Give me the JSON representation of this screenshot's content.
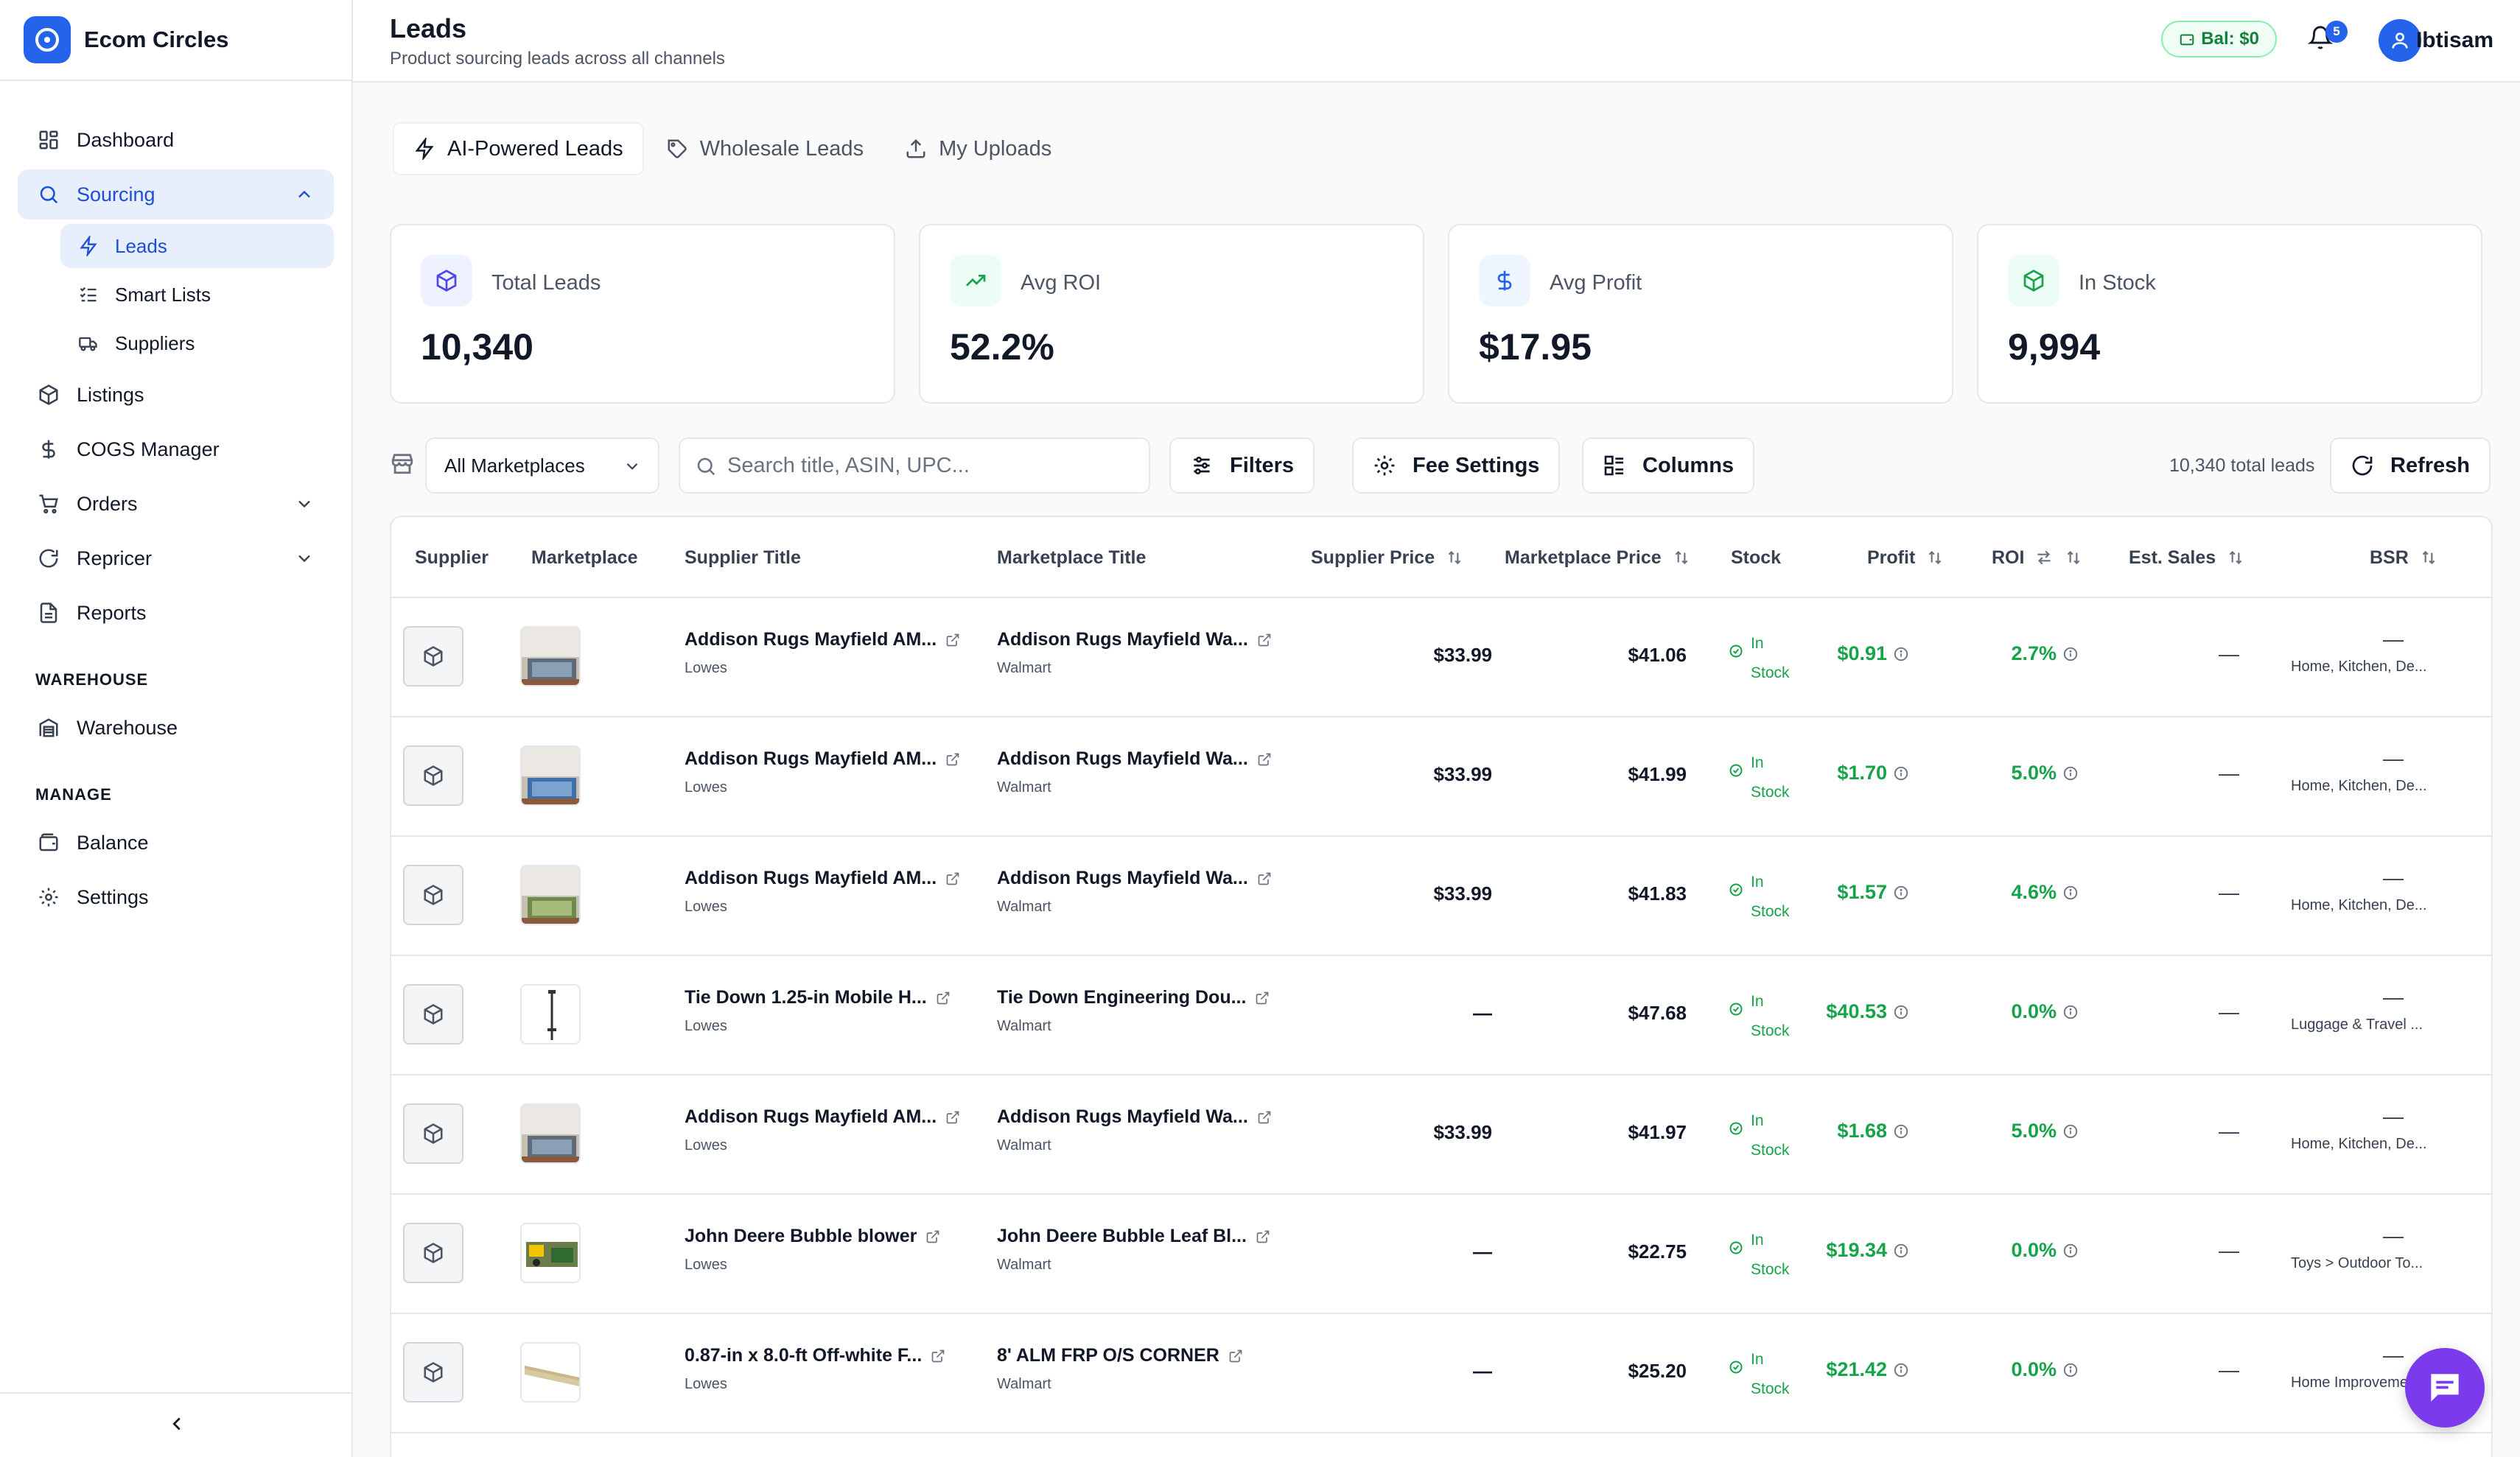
{
  "brand": {
    "name": "Ecom Circles"
  },
  "sidebar": {
    "items": [
      {
        "label": "Dashboard"
      },
      {
        "label": "Sourcing"
      },
      {
        "label": "Listings"
      },
      {
        "label": "COGS Manager"
      },
      {
        "label": "Orders"
      },
      {
        "label": "Repricer"
      },
      {
        "label": "Reports"
      }
    ],
    "sourcing_sub": [
      {
        "label": "Leads"
      },
      {
        "label": "Smart Lists"
      },
      {
        "label": "Suppliers"
      }
    ],
    "warehouse_label": "WAREHOUSE",
    "warehouse_item": "Warehouse",
    "manage_label": "MANAGE",
    "manage_items": [
      {
        "label": "Balance"
      },
      {
        "label": "Settings"
      }
    ]
  },
  "header": {
    "title": "Leads",
    "subtitle": "Product sourcing leads across all channels",
    "balance": "Bal: $0",
    "notifications": "5",
    "user": "Ibtisam"
  },
  "tabs": [
    {
      "label": "AI-Powered Leads"
    },
    {
      "label": "Wholesale Leads"
    },
    {
      "label": "My Uploads"
    }
  ],
  "stats": [
    {
      "label": "Total Leads",
      "value": "10,340",
      "color": "#4f46e5"
    },
    {
      "label": "Avg ROI",
      "value": "52.2%",
      "color": "#16a34a"
    },
    {
      "label": "Avg Profit",
      "value": "$17.95",
      "color": "#2563eb"
    },
    {
      "label": "In Stock",
      "value": "9,994",
      "color": "#16a34a"
    }
  ],
  "toolbar": {
    "marketplace": "All Marketplaces",
    "search_placeholder": "Search title, ASIN, UPC...",
    "filters": "Filters",
    "fee_settings": "Fee Settings",
    "columns": "Columns",
    "total": "10,340 total leads",
    "refresh": "Refresh"
  },
  "table": {
    "headers": {
      "supplier": "Supplier",
      "marketplace": "Marketplace",
      "supplier_title": "Supplier Title",
      "marketplace_title": "Marketplace Title",
      "supplier_price": "Supplier Price",
      "marketplace_price": "Marketplace Price",
      "stock": "Stock",
      "profit": "Profit",
      "roi": "ROI",
      "est_sales": "Est. Sales",
      "bsr": "BSR"
    },
    "rows": [
      {
        "sup_title": "Addison Rugs Mayfield AM...",
        "sup_store": "Lowes",
        "mp_title": "Addison Rugs Mayfield Wa...",
        "mp_store": "Walmart",
        "sup_price": "$33.99",
        "mp_price": "$41.06",
        "stock1": "In",
        "stock2": "Stock",
        "profit": "$0.91",
        "roi": "2.7%",
        "sales": "—",
        "bsr": "—",
        "cat": "Home, Kitchen, De...",
        "thumb": "rug"
      },
      {
        "sup_title": "Addison Rugs Mayfield AM...",
        "sup_store": "Lowes",
        "mp_title": "Addison Rugs Mayfield Wa...",
        "mp_store": "Walmart",
        "sup_price": "$33.99",
        "mp_price": "$41.99",
        "stock1": "In",
        "stock2": "Stock",
        "profit": "$1.70",
        "roi": "5.0%",
        "sales": "—",
        "bsr": "—",
        "cat": "Home, Kitchen, De...",
        "thumb": "rug-blue"
      },
      {
        "sup_title": "Addison Rugs Mayfield AM...",
        "sup_store": "Lowes",
        "mp_title": "Addison Rugs Mayfield Wa...",
        "mp_store": "Walmart",
        "sup_price": "$33.99",
        "mp_price": "$41.83",
        "stock1": "In",
        "stock2": "Stock",
        "profit": "$1.57",
        "roi": "4.6%",
        "sales": "—",
        "bsr": "—",
        "cat": "Home, Kitchen, De...",
        "thumb": "rug-green"
      },
      {
        "sup_title": "Tie Down 1.25-in Mobile H...",
        "sup_store": "Lowes",
        "mp_title": "Tie Down Engineering Dou...",
        "mp_store": "Walmart",
        "sup_price": "—",
        "mp_price": "$47.68",
        "stock1": "In",
        "stock2": "Stock",
        "profit": "$40.53",
        "roi": "0.0%",
        "sales": "—",
        "bsr": "—",
        "cat": "Luggage & Travel ...",
        "thumb": "rod"
      },
      {
        "sup_title": "Addison Rugs Mayfield AM...",
        "sup_store": "Lowes",
        "mp_title": "Addison Rugs Mayfield Wa...",
        "mp_store": "Walmart",
        "sup_price": "$33.99",
        "mp_price": "$41.97",
        "stock1": "In",
        "stock2": "Stock",
        "profit": "$1.68",
        "roi": "5.0%",
        "sales": "—",
        "bsr": "—",
        "cat": "Home, Kitchen, De...",
        "thumb": "rug"
      },
      {
        "sup_title": "John Deere Bubble blower",
        "sup_store": "Lowes",
        "mp_title": "John Deere Bubble Leaf Bl...",
        "mp_store": "Walmart",
        "sup_price": "—",
        "mp_price": "$22.75",
        "stock1": "In",
        "stock2": "Stock",
        "profit": "$19.34",
        "roi": "0.0%",
        "sales": "—",
        "bsr": "—",
        "cat": "Toys > Outdoor To...",
        "thumb": "toy"
      },
      {
        "sup_title": "0.87-in x 8.0-ft Off-white F...",
        "sup_store": "Lowes",
        "mp_title": "8' ALM FRP O/S CORNER",
        "mp_store": "Walmart",
        "sup_price": "—",
        "mp_price": "$25.20",
        "stock1": "In",
        "stock2": "Stock",
        "profit": "$21.42",
        "roi": "0.0%",
        "sales": "—",
        "bsr": "—",
        "cat": "Home Improveme...",
        "thumb": "trim"
      }
    ]
  }
}
